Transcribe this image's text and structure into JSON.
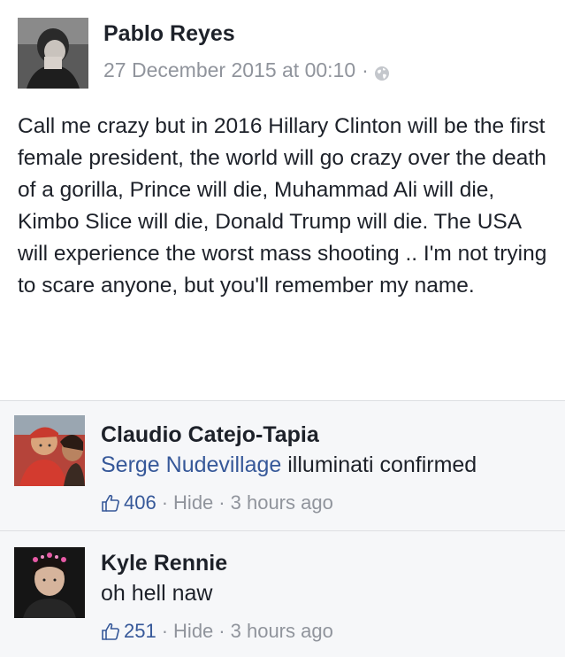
{
  "post": {
    "author": "Pablo Reyes",
    "timestamp": "27 December 2015 at 00:10",
    "separator": "·",
    "privacy_icon": "globe-icon",
    "text": "Call me crazy but in 2016 Hillary Clinton will be the first female president, the world will go crazy over the death of a gorilla, Prince will die, Muhammad Ali will die, Kimbo Slice will die, Donald Trump will die. The USA will experience the worst mass shooting .. I'm not trying to scare anyone, but you'll remember my name."
  },
  "comments": [
    {
      "author": "Claudio Catejo-Tapia",
      "tagged_name": "Serge Nudevillage",
      "text": "illuminati confirmed",
      "like_icon": "thumbs-up-icon",
      "likes": "406",
      "hide_label": "Hide",
      "separator": "·",
      "time": "3 hours ago"
    },
    {
      "author": "Kyle Rennie",
      "text": "oh hell naw",
      "like_icon": "thumbs-up-icon",
      "likes": "251",
      "hide_label": "Hide",
      "separator": "·",
      "time": "3 hours ago"
    }
  ],
  "colors": {
    "link_blue": "#365899",
    "meta_grey": "#90949c",
    "text": "#1d2129",
    "comment_bg": "#f6f7f9",
    "divider": "#dddfe2"
  }
}
